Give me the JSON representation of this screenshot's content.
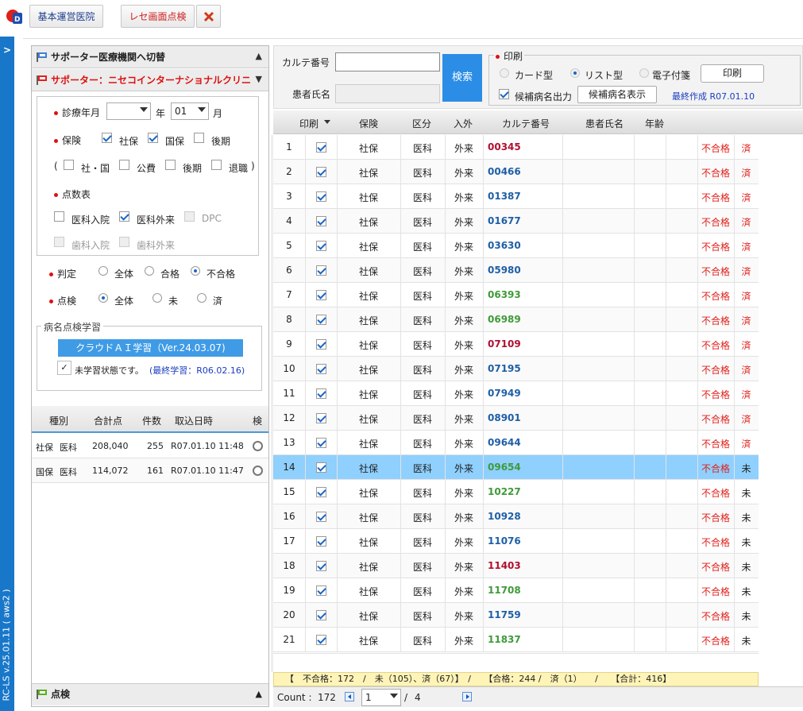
{
  "toolbar": {
    "clinic_button": "基本運営医院",
    "rece_check_button": "レセ画面点検",
    "close_icon": "x-icon"
  },
  "sidebar_strip": {
    "version": "RC-LS v.25.01.11 ( aws2 )"
  },
  "left_panel": {
    "switch_supporter": "サポーター医療機関へ切替",
    "supporter_name": "サポーター：ニセコインターナショナルクリニ",
    "treat_month_label": "診療年月",
    "year_value": "",
    "year_unit": "年",
    "month_value": "01",
    "month_unit": "月",
    "insurance_label": "保険",
    "ins_shaho": "社保",
    "ins_kokuho": "国保",
    "ins_kouki": "後期",
    "paren_open": "(",
    "sub_shaho_kokuho": "社・国",
    "sub_kouhi": "公費",
    "sub_kouki": "後期",
    "sub_taishoku": "退職",
    "paren_close": ")",
    "score_table_label": "点数表",
    "st_ika_nyuin": "医科入院",
    "st_ika_gairai": "医科外来",
    "st_dpc": "DPC",
    "st_shika_nyuin": "歯科入院",
    "st_shika_gairai": "歯科外来",
    "judge_label": "判定",
    "judge_all": "全体",
    "judge_pass": "合格",
    "judge_fail": "不合格",
    "check_label": "点検",
    "check_all": "全体",
    "check_not": "未",
    "check_done": "済",
    "learning_legend": "病名点検学習",
    "ai_button": "クラウドＡＩ学習（Ver.24.03.07)",
    "unlearned_text": "未学習状態です。",
    "last_learn": "(最終学習：R06.02.16)",
    "table_headers": [
      "種別",
      "合計点",
      "件数",
      "取込日時",
      "検"
    ],
    "table_rows": [
      {
        "type1": "社保",
        "type2": "医科",
        "total": "208,040",
        "count": "255",
        "date": "R07.01.10 11:48"
      },
      {
        "type1": "国保",
        "type2": "医科",
        "total": "114,072",
        "count": "161",
        "date": "R07.01.10 11:47"
      }
    ],
    "bottom_acc": "点検"
  },
  "search": {
    "karte_label": "カルテ番号",
    "karte_value": "",
    "patient_label": "患者氏名",
    "patient_value": "",
    "search_button": "検索"
  },
  "print_box": {
    "legend": "印刷",
    "card_type": "カード型",
    "list_type": "リスト型",
    "sticky_type": "電子付箋",
    "print_button": "印刷",
    "candidate_output": "候補病名出力",
    "candidate_show_button": "候補病名表示",
    "last_created": "最終作成 R07.01.10"
  },
  "grid": {
    "headers": [
      "印刷",
      "保険",
      "区分",
      "入外",
      "カルテ番号",
      "患者氏名",
      "年齢"
    ],
    "rows": [
      {
        "no": "1",
        "ins": "社保",
        "kubun": "医科",
        "io": "外来",
        "karte": "00345",
        "kc": "#b01030",
        "judge": "不合格",
        "chk": "済"
      },
      {
        "no": "2",
        "ins": "社保",
        "kubun": "医科",
        "io": "外来",
        "karte": "00466",
        "kc": "#1f5fa6",
        "judge": "不合格",
        "chk": "済"
      },
      {
        "no": "3",
        "ins": "社保",
        "kubun": "医科",
        "io": "外来",
        "karte": "01387",
        "kc": "#1f5fa6",
        "judge": "不合格",
        "chk": "済"
      },
      {
        "no": "4",
        "ins": "社保",
        "kubun": "医科",
        "io": "外来",
        "karte": "01677",
        "kc": "#1f5fa6",
        "judge": "不合格",
        "chk": "済"
      },
      {
        "no": "5",
        "ins": "社保",
        "kubun": "医科",
        "io": "外来",
        "karte": "03630",
        "kc": "#1f5fa6",
        "judge": "不合格",
        "chk": "済"
      },
      {
        "no": "6",
        "ins": "社保",
        "kubun": "医科",
        "io": "外来",
        "karte": "05980",
        "kc": "#1f5fa6",
        "judge": "不合格",
        "chk": "済"
      },
      {
        "no": "7",
        "ins": "社保",
        "kubun": "医科",
        "io": "外来",
        "karte": "06393",
        "kc": "#3f9a3a",
        "judge": "不合格",
        "chk": "済"
      },
      {
        "no": "8",
        "ins": "社保",
        "kubun": "医科",
        "io": "外来",
        "karte": "06989",
        "kc": "#3f9a3a",
        "judge": "不合格",
        "chk": "済"
      },
      {
        "no": "9",
        "ins": "社保",
        "kubun": "医科",
        "io": "外来",
        "karte": "07109",
        "kc": "#b01030",
        "judge": "不合格",
        "chk": "済"
      },
      {
        "no": "10",
        "ins": "社保",
        "kubun": "医科",
        "io": "外来",
        "karte": "07195",
        "kc": "#1f5fa6",
        "judge": "不合格",
        "chk": "済"
      },
      {
        "no": "11",
        "ins": "社保",
        "kubun": "医科",
        "io": "外来",
        "karte": "07949",
        "kc": "#1f5fa6",
        "judge": "不合格",
        "chk": "済"
      },
      {
        "no": "12",
        "ins": "社保",
        "kubun": "医科",
        "io": "外来",
        "karte": "08901",
        "kc": "#1f5fa6",
        "judge": "不合格",
        "chk": "済"
      },
      {
        "no": "13",
        "ins": "社保",
        "kubun": "医科",
        "io": "外来",
        "karte": "09644",
        "kc": "#1f5fa6",
        "judge": "不合格",
        "chk": "済"
      },
      {
        "no": "14",
        "ins": "社保",
        "kubun": "医科",
        "io": "外来",
        "karte": "09654",
        "kc": "#3f9a3a",
        "judge": "不合格",
        "chk": "未"
      },
      {
        "no": "15",
        "ins": "社保",
        "kubun": "医科",
        "io": "外来",
        "karte": "10227",
        "kc": "#3f9a3a",
        "judge": "不合格",
        "chk": "未"
      },
      {
        "no": "16",
        "ins": "社保",
        "kubun": "医科",
        "io": "外来",
        "karte": "10928",
        "kc": "#1f5fa6",
        "judge": "不合格",
        "chk": "未"
      },
      {
        "no": "17",
        "ins": "社保",
        "kubun": "医科",
        "io": "外来",
        "karte": "11076",
        "kc": "#1f5fa6",
        "judge": "不合格",
        "chk": "未"
      },
      {
        "no": "18",
        "ins": "社保",
        "kubun": "医科",
        "io": "外来",
        "karte": "11403",
        "kc": "#b01030",
        "judge": "不合格",
        "chk": "未"
      },
      {
        "no": "19",
        "ins": "社保",
        "kubun": "医科",
        "io": "外来",
        "karte": "11708",
        "kc": "#3f9a3a",
        "judge": "不合格",
        "chk": "未"
      },
      {
        "no": "20",
        "ins": "社保",
        "kubun": "医科",
        "io": "外来",
        "karte": "11759",
        "kc": "#1f5fa6",
        "judge": "不合格",
        "chk": "未"
      },
      {
        "no": "21",
        "ins": "社保",
        "kubun": "医科",
        "io": "外来",
        "karte": "11837",
        "kc": "#3f9a3a",
        "judge": "不合格",
        "chk": "未"
      }
    ],
    "selected_row": "14"
  },
  "summary": "【　不合格：172　/　未（105）、済（67）】　/　　【合格：244 /　済（1）　　/　　【合計：416】",
  "footer": {
    "count_label": "Count :",
    "count_value": "172",
    "page_value": "1",
    "page_sep": "/",
    "page_total": "4"
  },
  "colors": {
    "accent": "#1877c9",
    "search_button": "#2b8de6",
    "selected_row": "#8fd0ff",
    "fail": "#e0201b"
  }
}
